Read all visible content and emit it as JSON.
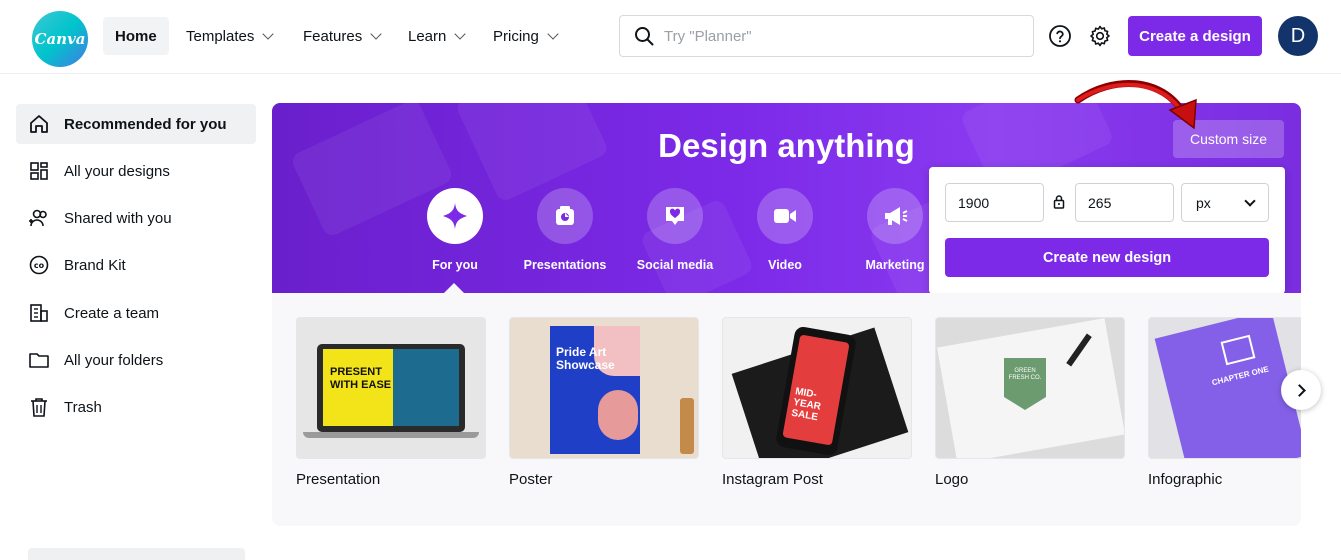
{
  "brand": {
    "logo_text": "Canva",
    "accent": "#7d2ae8",
    "logo_color": "#00c4cc"
  },
  "nav": {
    "items": [
      {
        "label": "Home",
        "active": true
      },
      {
        "label": "Templates",
        "has_dropdown": true
      },
      {
        "label": "Features",
        "has_dropdown": true
      },
      {
        "label": "Learn",
        "has_dropdown": true
      },
      {
        "label": "Pricing",
        "has_dropdown": true
      }
    ],
    "search_placeholder": "Try \"Planner\"",
    "help_icon": "help-circle-icon",
    "settings_icon": "gear-icon",
    "create_label": "Create a design",
    "avatar_initial": "D"
  },
  "sidebar": {
    "items": [
      {
        "label": "Recommended for you",
        "icon": "home-icon",
        "active": true
      },
      {
        "label": "All your designs",
        "icon": "grid-icon"
      },
      {
        "label": "Shared with you",
        "icon": "people-add-icon"
      },
      {
        "label": "Brand Kit",
        "icon": "brand-kit-icon"
      },
      {
        "label": "Create a team",
        "icon": "building-icon"
      },
      {
        "label": "All your folders",
        "icon": "folder-icon"
      },
      {
        "label": "Trash",
        "icon": "trash-icon"
      }
    ]
  },
  "hero": {
    "title": "Design anything",
    "custom_size_label": "Custom size",
    "categories": [
      {
        "label": "For you",
        "icon": "sparkle-icon",
        "active": true
      },
      {
        "label": "Presentations",
        "icon": "presentation-icon"
      },
      {
        "label": "Social media",
        "icon": "heart-chat-icon"
      },
      {
        "label": "Video",
        "icon": "video-camera-icon"
      },
      {
        "label": "Marketing",
        "icon": "megaphone-icon"
      }
    ]
  },
  "custom_size": {
    "width": "1900",
    "height": "265",
    "unit": "px",
    "create_label": "Create new design"
  },
  "templates": [
    {
      "label": "Presentation",
      "thumb_text": "PRESENT WITH EASE"
    },
    {
      "label": "Poster",
      "thumb_text": "Pride Art Showcase"
    },
    {
      "label": "Instagram Post",
      "thumb_text": "MID-YEAR SALE"
    },
    {
      "label": "Logo",
      "thumb_text": "GREEN FRESH CO."
    },
    {
      "label": "Infographic",
      "thumb_text": "CHAPTER ONE"
    }
  ]
}
